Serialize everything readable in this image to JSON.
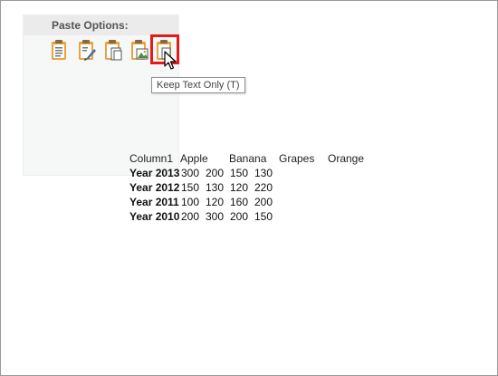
{
  "paste_options": {
    "title": "Paste Options:",
    "buttons": [
      {
        "name": "keep-source-formatting",
        "icon": "clipboard-icon"
      },
      {
        "name": "merge-formatting",
        "icon": "clipboard-brush-icon"
      },
      {
        "name": "use-destination-styles",
        "icon": "clipboard-pages-icon"
      },
      {
        "name": "picture",
        "icon": "clipboard-picture-icon"
      },
      {
        "name": "keep-text-only",
        "icon": "clipboard-text-icon"
      }
    ],
    "tooltip": "Keep Text Only (T)"
  },
  "pasted_text": {
    "header": [
      "Column1",
      "Apple",
      "Banana",
      "Grapes",
      "Orange"
    ],
    "rows": [
      [
        "Year 2013",
        "300",
        "200",
        "150",
        "130"
      ],
      [
        "Year 2012",
        "150",
        "130",
        "120",
        "220"
      ],
      [
        "Year 2011",
        "100",
        "120",
        "160",
        "200"
      ],
      [
        "Year 2010",
        "200",
        "300",
        "200",
        "150"
      ]
    ]
  },
  "colors": {
    "highlight_border": "#e31b1b",
    "icon_orange": "#e8a33d"
  }
}
